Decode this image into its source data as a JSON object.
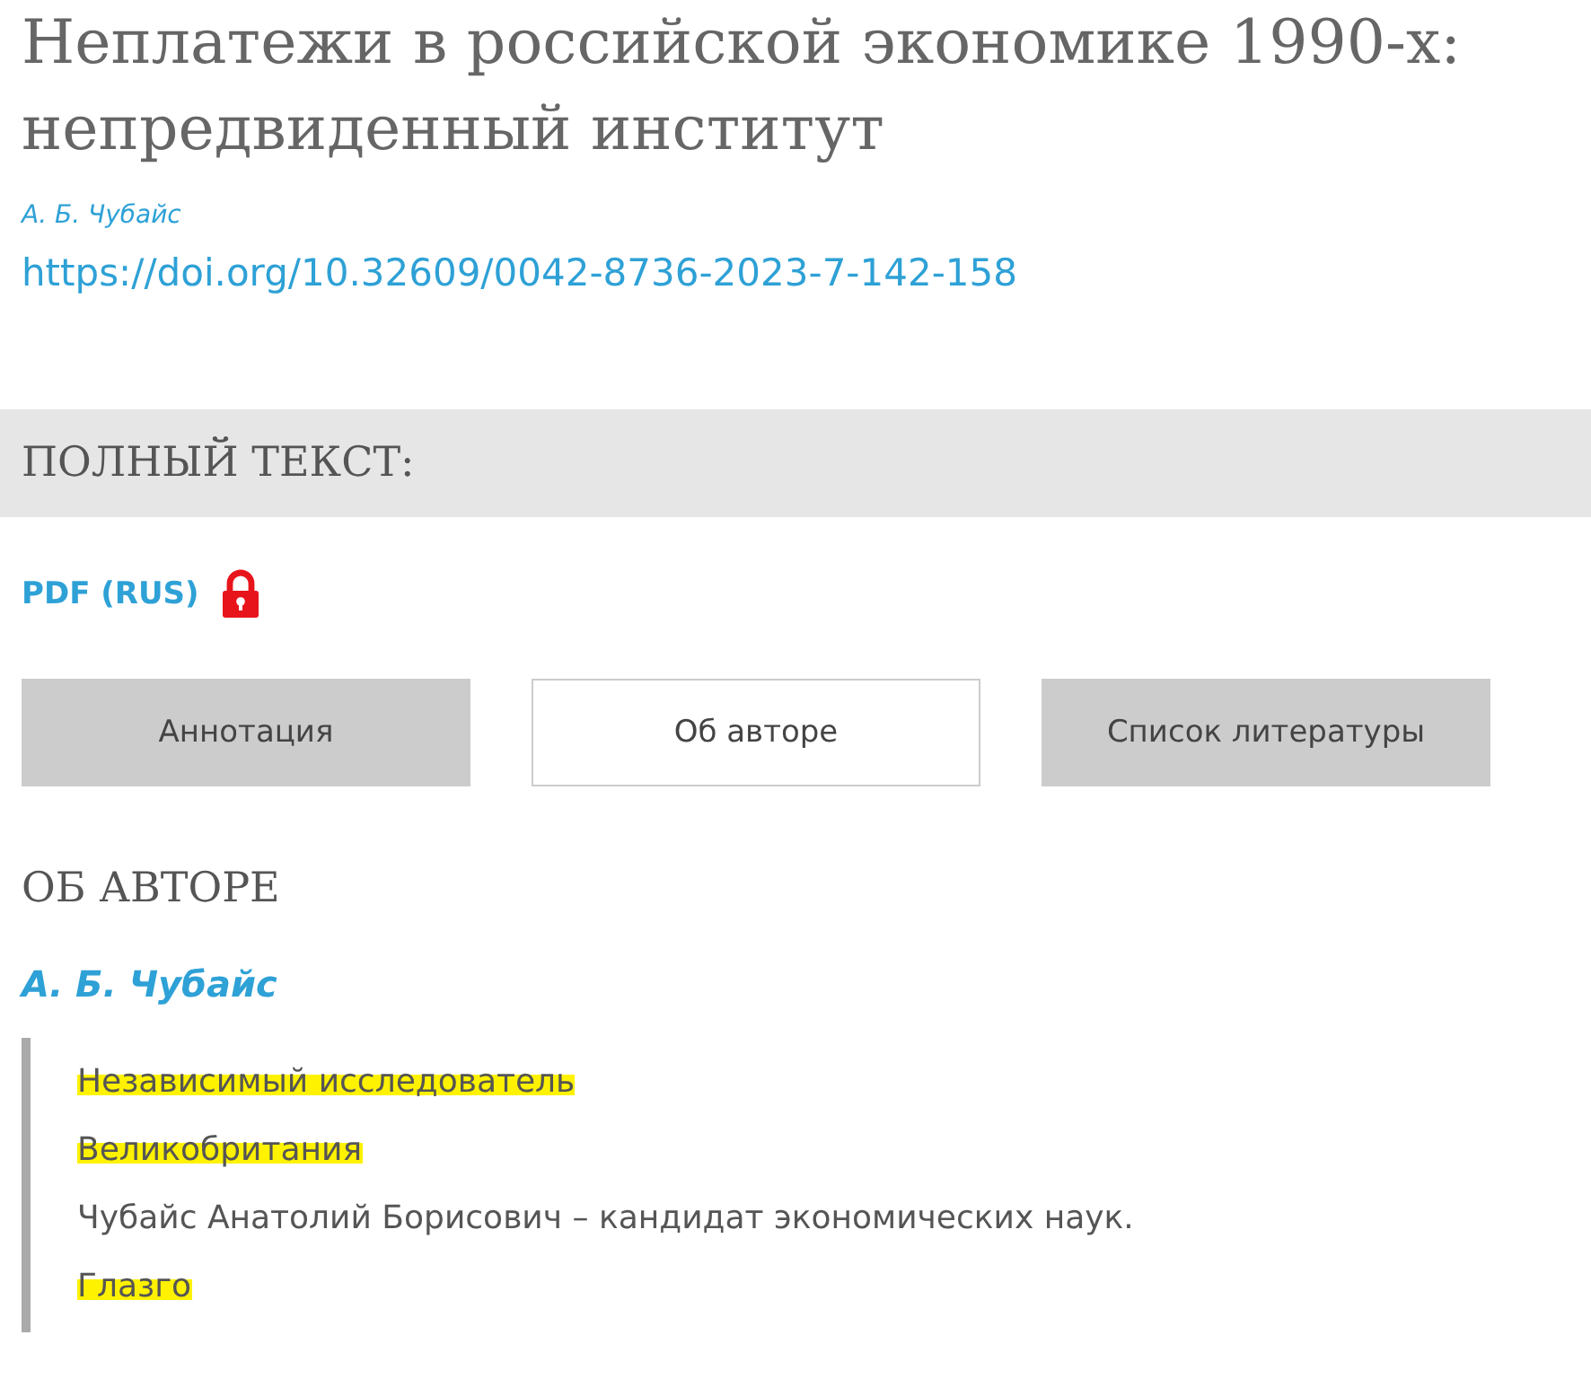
{
  "title": "Неплатежи в российской экономике 1990-х: непредвиденный институт",
  "author": "А. Б. Чубайс",
  "doi": "https://doi.org/10.32609/0042-8736-2023-7-142-158",
  "full_text": {
    "heading": "ПОЛНЫЙ ТЕКСТ:",
    "pdf_link": "PDF (RUS)",
    "locked": true
  },
  "tabs": [
    {
      "label": "Аннотация",
      "selected": false
    },
    {
      "label": "Об авторе",
      "selected": true
    },
    {
      "label": "Список литературы",
      "selected": false
    }
  ],
  "section_heading": "ОБ АВТОРЕ",
  "author_name": "А. Б. Чубайс",
  "author_lines": [
    {
      "text": "Независимый исследователь",
      "highlighted": true
    },
    {
      "text": "Великобритания",
      "highlighted": true
    },
    {
      "text": "Чубайс Анатолий Борисович – кандидат экономических наук.",
      "highlighted": false
    },
    {
      "text": "Глазго",
      "highlighted": true
    }
  ]
}
